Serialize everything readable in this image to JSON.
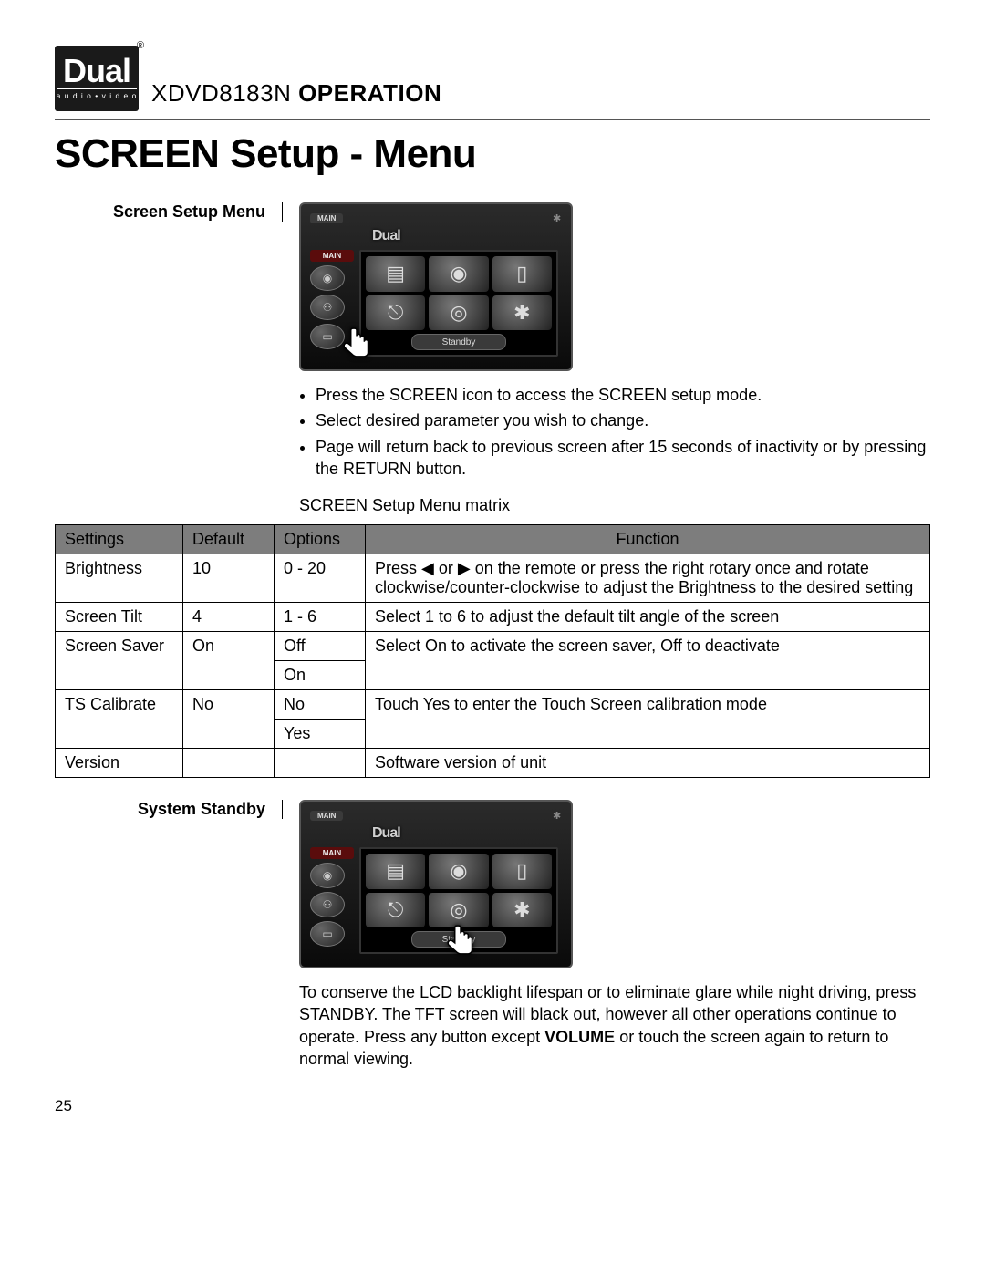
{
  "logo": {
    "brand": "Dual",
    "sub": "a u d i o • v i d e o",
    "reg": "®"
  },
  "header": {
    "model": "XDVD8183N",
    "op": " OPERATION"
  },
  "page_title": "SCREEN Setup - Menu",
  "section1": {
    "label": "Screen Setup Menu",
    "screenshot": {
      "main_badge_top": "MAIN",
      "main_badge_left": "MAIN",
      "brand": "Dual",
      "standby": "Standby"
    },
    "bullets": [
      "Press the SCREEN icon to access the SCREEN setup mode.",
      "Select desired parameter you wish to change.",
      "Page will return back to previous screen after 15 seconds of inactivity or by pressing the RETURN button."
    ],
    "matrix_label": "SCREEN Setup Menu matrix"
  },
  "table": {
    "headers": {
      "settings": "Settings",
      "default": "Default",
      "options": "Options",
      "function": "Function"
    },
    "rows": [
      {
        "setting": "Brightness",
        "default": "10",
        "options": [
          "0 - 20"
        ],
        "function": "Press ◀ or ▶ on the remote or press the right rotary once and rotate clockwise/counter-clockwise to adjust the Brightness to the desired setting"
      },
      {
        "setting": "Screen Tilt",
        "default": "4",
        "options": [
          "1 - 6"
        ],
        "function": "Select 1 to 6 to adjust the default tilt angle of the screen"
      },
      {
        "setting": "Screen Saver",
        "default": "On",
        "options": [
          "Off",
          "On"
        ],
        "function": "Select On to activate the screen saver, Off to deactivate"
      },
      {
        "setting": "TS Calibrate",
        "default": "No",
        "options": [
          "No",
          "Yes"
        ],
        "function": "Touch Yes to enter the Touch Screen calibration mode"
      },
      {
        "setting": "Version",
        "default": "",
        "options": [
          ""
        ],
        "function": "Software version of unit"
      }
    ]
  },
  "section2": {
    "label": "System Standby",
    "text_pre": "To conserve the LCD backlight lifespan or to eliminate glare while night driving, press STANDBY. The TFT screen will black out, however all other operations continue to operate. Press any button except ",
    "text_bold": "VOLUME",
    "text_post": " or touch the screen again to return to normal viewing."
  },
  "page_num": "25"
}
